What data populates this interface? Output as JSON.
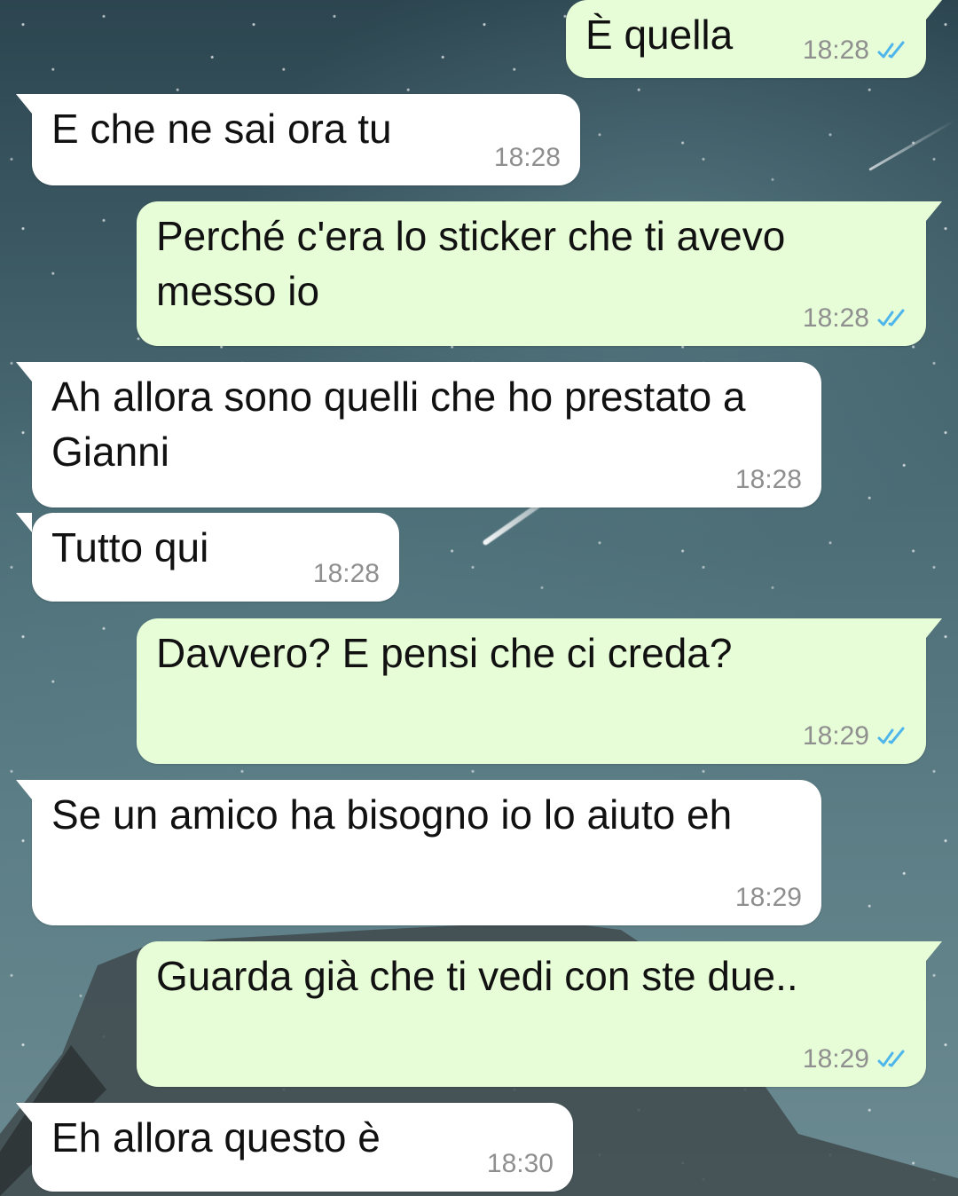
{
  "theme": {
    "incoming_bg": "#ffffff",
    "outgoing_bg": "#e7fdd7",
    "time_color": "#8f8f8f",
    "read_tick_color": "#4fb6ec"
  },
  "messages": [
    {
      "direction": "out",
      "text": "È quella",
      "time": "18:28",
      "status": "read"
    },
    {
      "direction": "in",
      "text": "E che ne sai ora tu",
      "time": "18:28"
    },
    {
      "direction": "out",
      "text": "Perché c'era lo sticker che ti avevo messo io",
      "time": "18:28",
      "status": "read"
    },
    {
      "direction": "in",
      "text": "Ah allora sono quelli che ho prestato a Gianni",
      "time": "18:28"
    },
    {
      "direction": "in",
      "text": "Tutto qui",
      "time": "18:28"
    },
    {
      "direction": "out",
      "text": "Davvero? E pensi che ci creda?",
      "time": "18:29",
      "status": "read"
    },
    {
      "direction": "in",
      "text": "Se un amico ha bisogno io lo aiuto eh",
      "time": "18:29"
    },
    {
      "direction": "out",
      "text": "Guarda già che ti vedi con ste due..",
      "time": "18:29",
      "status": "read"
    },
    {
      "direction": "in",
      "text": "Eh allora questo è",
      "time": "18:30"
    }
  ]
}
